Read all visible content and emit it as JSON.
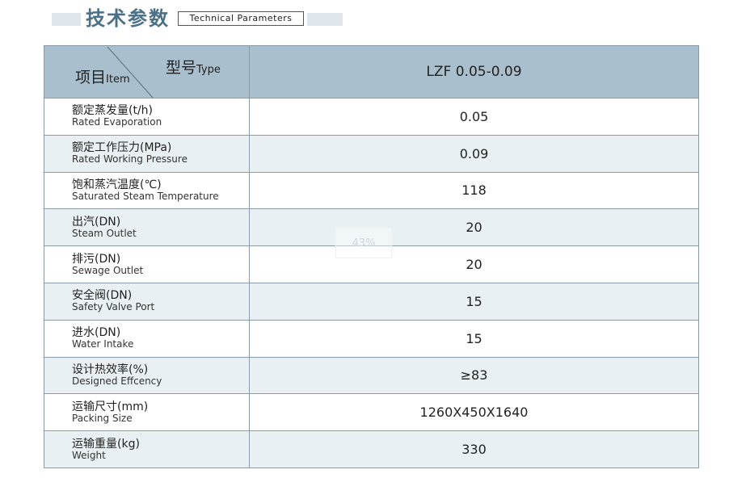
{
  "heading": {
    "title_cn": "技术参数",
    "title_en": "Technical Parameters"
  },
  "table": {
    "header": {
      "type_cn": "型号",
      "type_en": "Type",
      "item_cn": "项目",
      "item_en": "Item",
      "model": "LZF 0.05-0.09"
    },
    "rows": [
      {
        "label_cn": "额定蒸发量(t/h)",
        "label_en": "Rated  Evaporation",
        "value": "0.05"
      },
      {
        "label_cn": "额定工作压力(MPa)",
        "label_en": "Rated  Working  Pressure",
        "value": "0.09"
      },
      {
        "label_cn": "饱和蒸汽温度(℃)",
        "label_en": "Saturated  Steam  Temperature",
        "value": "118"
      },
      {
        "label_cn": "出汽(DN)",
        "label_en": "Steam Outlet",
        "value": "20"
      },
      {
        "label_cn": "排污(DN)",
        "label_en": "Sewage Outlet",
        "value": "20"
      },
      {
        "label_cn": "安全阀(DN)",
        "label_en": "Safety Valve Port",
        "value": "15"
      },
      {
        "label_cn": "进水(DN)",
        "label_en": "Water Intake",
        "value": "15"
      },
      {
        "label_cn": "设计热效率(%)",
        "label_en": "Designed Effcency",
        "value": "≥83"
      },
      {
        "label_cn": "运输尺寸(mm)",
        "label_en": "Packing Size",
        "value": "1260X450X1640"
      },
      {
        "label_cn": "运输重量(kg)",
        "label_en": "Weight",
        "value": "330"
      }
    ]
  },
  "watermark": "43%",
  "colors": {
    "header_bg": "#a9bfcd",
    "stripe_bg": "#e8f0f3",
    "title_color": "#4a6f86",
    "border": "#8a9aa6"
  }
}
